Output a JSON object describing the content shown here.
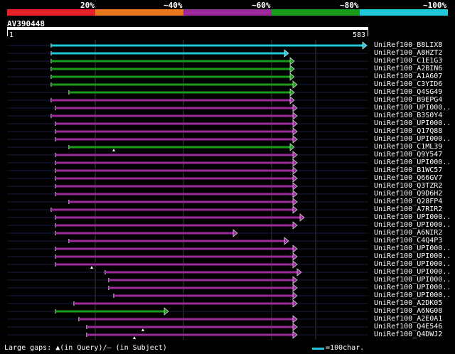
{
  "legend": [
    {
      "label": "20%",
      "color": "#e8202a"
    },
    {
      "label": "~40%",
      "color": "#e8771e"
    },
    {
      "label": "~60%",
      "color": "#9c2a9c"
    },
    {
      "label": "~80%",
      "color": "#1a9c1a"
    },
    {
      "label": "~100%",
      "color": "#1ec8d8"
    }
  ],
  "query": {
    "name": "AV390448",
    "start": "1",
    "end": "583"
  },
  "hits": [
    {
      "name": "UniRef100_B8LIX8",
      "start": 72,
      "end": 516,
      "color": "#1ec8d8"
    },
    {
      "name": "UniRef100_A8HZT2",
      "start": 72,
      "end": 406,
      "color": "#1ec8d8"
    },
    {
      "name": "UniRef100_C1E1G3",
      "start": 72,
      "end": 414,
      "color": "#1a9c1a"
    },
    {
      "name": "UniRef100_A2BIN6",
      "start": 72,
      "end": 414,
      "color": "#1a9c1a"
    },
    {
      "name": "UniRef100_A1A607",
      "start": 72,
      "end": 414,
      "color": "#1a9c1a"
    },
    {
      "name": "UniRef100_C3YID6",
      "start": 72,
      "end": 418,
      "color": "#1a9c1a"
    },
    {
      "name": "UniRef100_Q4SG49",
      "start": 97,
      "end": 414,
      "color": "#1a9c1a"
    },
    {
      "name": "UniRef100_B9EPG4",
      "start": 72,
      "end": 414,
      "color": "#9c2a9c"
    },
    {
      "name": "UniRef100_UPI000..",
      "start": 78,
      "end": 418,
      "color": "#9c2a9c"
    },
    {
      "name": "UniRef100_B3S0Y4",
      "start": 72,
      "end": 418,
      "color": "#9c2a9c"
    },
    {
      "name": "UniRef100_UPI000..",
      "start": 78,
      "end": 418,
      "color": "#9c2a9c"
    },
    {
      "name": "UniRef100_Q17Q88",
      "start": 78,
      "end": 418,
      "color": "#9c2a9c"
    },
    {
      "name": "UniRef100_UPI000..",
      "start": 78,
      "end": 418,
      "color": "#9c2a9c"
    },
    {
      "name": "UniRef100_C1ML39",
      "start": 97,
      "end": 414,
      "color": "#1a9c1a",
      "gap": 160
    },
    {
      "name": "UniRef100_Q9Y547",
      "start": 78,
      "end": 418,
      "color": "#9c2a9c"
    },
    {
      "name": "UniRef100_UPI000..",
      "start": 78,
      "end": 418,
      "color": "#9c2a9c"
    },
    {
      "name": "UniRef100_B1WC57",
      "start": 78,
      "end": 418,
      "color": "#9c2a9c"
    },
    {
      "name": "UniRef100_Q66GV7",
      "start": 78,
      "end": 418,
      "color": "#9c2a9c"
    },
    {
      "name": "UniRef100_Q3TZR2",
      "start": 78,
      "end": 418,
      "color": "#9c2a9c"
    },
    {
      "name": "UniRef100_Q9D6H2",
      "start": 78,
      "end": 418,
      "color": "#9c2a9c"
    },
    {
      "name": "UniRef100_Q28FP4",
      "start": 97,
      "end": 418,
      "color": "#9c2a9c"
    },
    {
      "name": "UniRef100_A7RIR2",
      "start": 72,
      "end": 418,
      "color": "#9c2a9c"
    },
    {
      "name": "UniRef100_UPI000..",
      "start": 78,
      "end": 428,
      "color": "#9c2a9c"
    },
    {
      "name": "UniRef100_UPI000..",
      "start": 78,
      "end": 418,
      "color": "#9c2a9c"
    },
    {
      "name": "UniRef100_A6NIR2",
      "start": 78,
      "end": 334,
      "color": "#9c2a9c"
    },
    {
      "name": "UniRef100_C4Q4P3",
      "start": 97,
      "end": 406,
      "color": "#9c2a9c"
    },
    {
      "name": "UniRef100_UPI000..",
      "start": 78,
      "end": 418,
      "color": "#9c2a9c"
    },
    {
      "name": "UniRef100_UPI000..",
      "start": 78,
      "end": 418,
      "color": "#9c2a9c"
    },
    {
      "name": "UniRef100_UPI000..",
      "start": 78,
      "end": 418,
      "color": "#9c2a9c",
      "gap": 129
    },
    {
      "name": "UniRef100_UPI000..",
      "start": 148,
      "end": 424,
      "color": "#9c2a9c"
    },
    {
      "name": "UniRef100_UPI000..",
      "start": 153,
      "end": 418,
      "color": "#9c2a9c"
    },
    {
      "name": "UniRef100_UPI000..",
      "start": 153,
      "end": 418,
      "color": "#9c2a9c"
    },
    {
      "name": "UniRef100_UPI000..",
      "start": 160,
      "end": 418,
      "color": "#9c2a9c"
    },
    {
      "name": "UniRef100_A2DK05",
      "start": 104,
      "end": 418,
      "color": "#9c2a9c"
    },
    {
      "name": "UniRef100_A6NG08",
      "start": 78,
      "end": 237,
      "color": "#1a9c1a"
    },
    {
      "name": "UniRef100_A2E0A1",
      "start": 111,
      "end": 418,
      "color": "#9c2a9c"
    },
    {
      "name": "UniRef100_Q4E546",
      "start": 122,
      "end": 418,
      "color": "#9c2a9c",
      "gap": 201
    },
    {
      "name": "UniRef100_Q4DWJ2",
      "start": 122,
      "end": 418,
      "color": "#9c2a9c",
      "gap": 189
    }
  ],
  "footer": {
    "gaps_text": "Large gaps: ▲(in Query)/— (in Subject)",
    "scale_text": "=100char."
  }
}
